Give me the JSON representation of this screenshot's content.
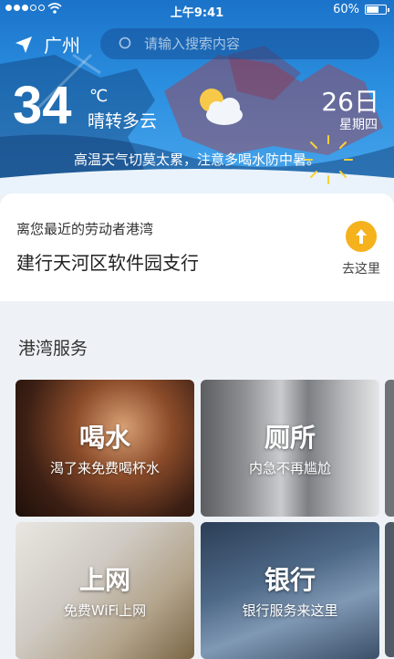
{
  "status_bar": {
    "time": "上午9:41",
    "battery": "60%"
  },
  "header": {
    "city": "广州",
    "search_placeholder": "请输入搜索内容",
    "temperature": "34",
    "temp_unit": "℃",
    "condition": "晴转多云",
    "date_day": "26日",
    "weekday": "星期四",
    "tip": "高温天气切莫太累，注意多喝水防中暑。"
  },
  "nearest": {
    "label": "离您最近的劳动者港湾",
    "name": "建行天河区软件园支行",
    "go_label": "去这里"
  },
  "services": {
    "title": "港湾服务",
    "items": [
      {
        "title": "喝水",
        "subtitle": "渴了来免费喝杯水"
      },
      {
        "title": "厕所",
        "subtitle": "内急不再尴尬"
      },
      {
        "title": "上网",
        "subtitle": "免费WiFi上网"
      },
      {
        "title": "银行",
        "subtitle": "银行服务来这里"
      }
    ]
  },
  "colors": {
    "header_blue": "#1b73c9",
    "go_button": "#f5b21d"
  },
  "icons": [
    "location-arrow-icon",
    "search-icon",
    "partly-cloudy-icon",
    "up-arrow-icon"
  ]
}
